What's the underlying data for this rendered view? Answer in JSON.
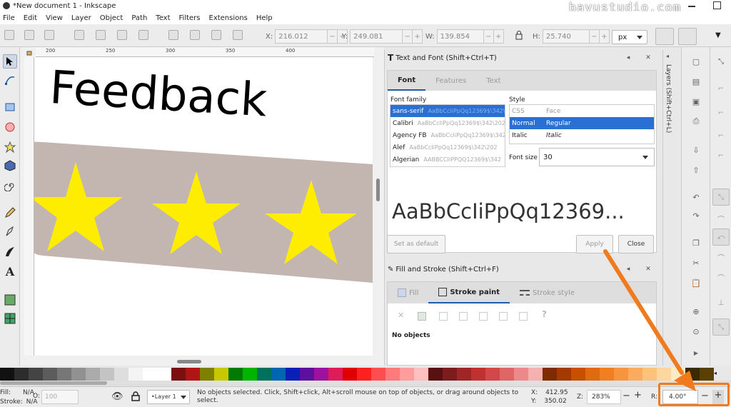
{
  "window": {
    "title": "*New document 1 - Inkscape",
    "watermark": "bayustudio.com"
  },
  "menu": [
    "File",
    "Edit",
    "View",
    "Layer",
    "Object",
    "Path",
    "Text",
    "Filters",
    "Extensions",
    "Help"
  ],
  "tool_controls": {
    "x_label": "X:",
    "x_value": "216.012",
    "y_label": "Y:",
    "y_value": "249.081",
    "w_label": "W:",
    "w_value": "139.854",
    "h_label": "H:",
    "h_value": "25.740",
    "unit": "px"
  },
  "ruler": [
    "200",
    "250",
    "300",
    "350",
    "400"
  ],
  "canvas": {
    "text": "Feedback",
    "banner_color": "#c3b5b0",
    "star_color": "#ffed00"
  },
  "text_font_dialog": {
    "title": "Text and Font (Shift+Ctrl+T)",
    "tabs": [
      "Font",
      "Features",
      "Text"
    ],
    "font_family_label": "Font family",
    "families": [
      {
        "name": "sans-serif",
        "sample": "AaBbCcIiPpQq12369$\\342\\202\\254"
      },
      {
        "name": "Calibri",
        "sample": "AaBbCcIiPpQq12369$\\342\\202"
      },
      {
        "name": "Agency FB",
        "sample": "AaBbCcIiPpQq12369$\\342\\202\\25"
      },
      {
        "name": "Alef",
        "sample": "AaBbCcIiPpQq12369$\\342\\202"
      },
      {
        "name": "Algerian",
        "sample": "AABBCCIIPPQQ12369$\\342"
      }
    ],
    "style_label": "Style",
    "style_headers": [
      "CSS",
      "Face"
    ],
    "styles": [
      {
        "css": "Normal",
        "face": "Regular"
      },
      {
        "css": "Italic",
        "face": "Italic"
      }
    ],
    "font_size_label": "Font size",
    "font_size": "30",
    "preview": "AaBbCcIiPpQq12369...",
    "set_default": "Set as default",
    "apply": "Apply",
    "close": "Close"
  },
  "fill_stroke_dialog": {
    "title": "Fill and Stroke (Shift+Ctrl+F)",
    "tabs": [
      "Fill",
      "Stroke paint",
      "Stroke style"
    ],
    "no_objects": "No objects",
    "unknown": "?"
  },
  "layers_label": "Layers (Shift+Ctrl+L)",
  "palette": [
    "#111111",
    "#2c2c2c",
    "#444444",
    "#5c5c5c",
    "#777777",
    "#919191",
    "#ababab",
    "#c4c4c4",
    "#dedede",
    "#f4f4f4",
    "#ffffff",
    "#ffffff",
    "#7b1010",
    "#b01515",
    "#7f7f00",
    "#c8c800",
    "#007a00",
    "#00b400",
    "#00705f",
    "#0066b2",
    "#0a1fb5",
    "#5d109e",
    "#9e109e",
    "#e01b5a",
    "#e00000",
    "#ff2020",
    "#ff4e4e",
    "#ff7a7a",
    "#ff9d9d",
    "#ffc0c0",
    "#5a1010",
    "#7d1c1c",
    "#a02626",
    "#c03030",
    "#d24747",
    "#e06666",
    "#ec8a8a",
    "#f5b0b0",
    "#802a00",
    "#a53a00",
    "#c84e00",
    "#e06a10",
    "#f07f22",
    "#f7953f",
    "#fbab5d",
    "#fdc27c",
    "#fdd79e",
    "#feebc4",
    "#3a2a00",
    "#5a4000"
  ],
  "status": {
    "fill_label": "Fill:",
    "fill_value": "N/A",
    "stroke_label": "Stroke:",
    "stroke_value": "N/A",
    "opacity_label": "O:",
    "opacity_value": "100",
    "layer": "•Layer 1",
    "message": "No objects selected. Click, Shift+click, Alt+scroll mouse on top of objects, or drag around objects to select.",
    "x_label": "X:",
    "x_value": "412.95",
    "y_label": "Y:",
    "y_value": "350.02",
    "zoom_label": "Z:",
    "zoom_value": "283%",
    "rotate_label": "R:",
    "rotate_value": "4.00°"
  },
  "accent": "#f07b1e"
}
